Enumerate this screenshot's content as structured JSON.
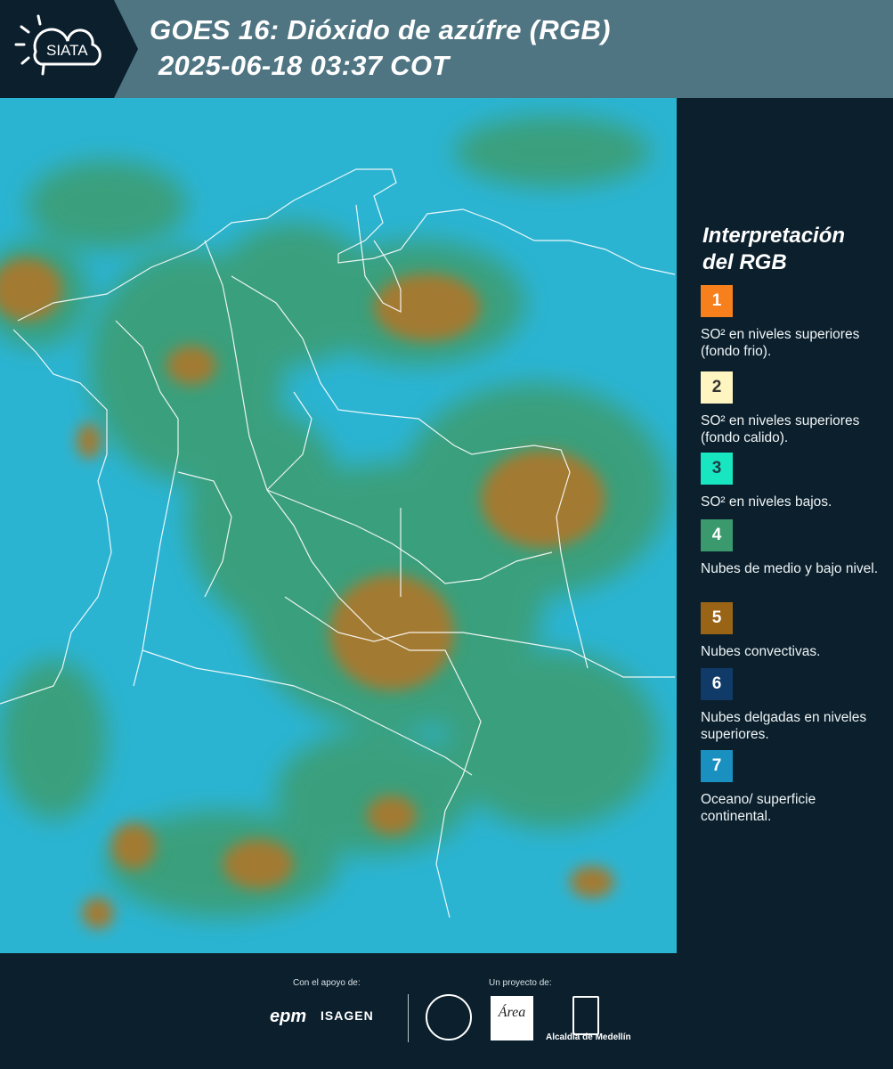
{
  "header": {
    "brand": "SIATA",
    "title_line1": "GOES 16: Dióxido de azúfre (RGB)",
    "title_line2": "2025-06-18 03:37 COT"
  },
  "legend": {
    "title": "Interpretación del RGB",
    "items": [
      {
        "num": "1",
        "color": "#f7801c",
        "text_color": "#ffffff",
        "label": "SO² en niveles superiores (fondo frio)."
      },
      {
        "num": "2",
        "color": "#fff5c0",
        "text_color": "#333333",
        "label": "SO² en niveles superiores (fondo calido)."
      },
      {
        "num": "3",
        "color": "#17e6c0",
        "text_color": "#1d3b44",
        "label": "SO² en niveles bajos."
      },
      {
        "num": "4",
        "color": "#3a9a6e",
        "text_color": "#ffffff",
        "label": "Nubes de medio y bajo nivel."
      },
      {
        "num": "5",
        "color": "#9a6416",
        "text_color": "#ffffff",
        "label": "Nubes convectivas."
      },
      {
        "num": "6",
        "color": "#103a68",
        "text_color": "#ffffff",
        "label": "Nubes delgadas en niveles superiores."
      },
      {
        "num": "7",
        "color": "#1a90c0",
        "text_color": "#ffffff",
        "label": "Oceano/ superficie continental."
      }
    ]
  },
  "footer": {
    "support_label": "Con el apoyo de:",
    "project_label": "Un proyecto de:",
    "sponsor_epm": "epm",
    "sponsor_isagen": "ISAGEN",
    "logo_area": "Área",
    "logo_alcaldia": "Alcaldía de Medellín"
  }
}
